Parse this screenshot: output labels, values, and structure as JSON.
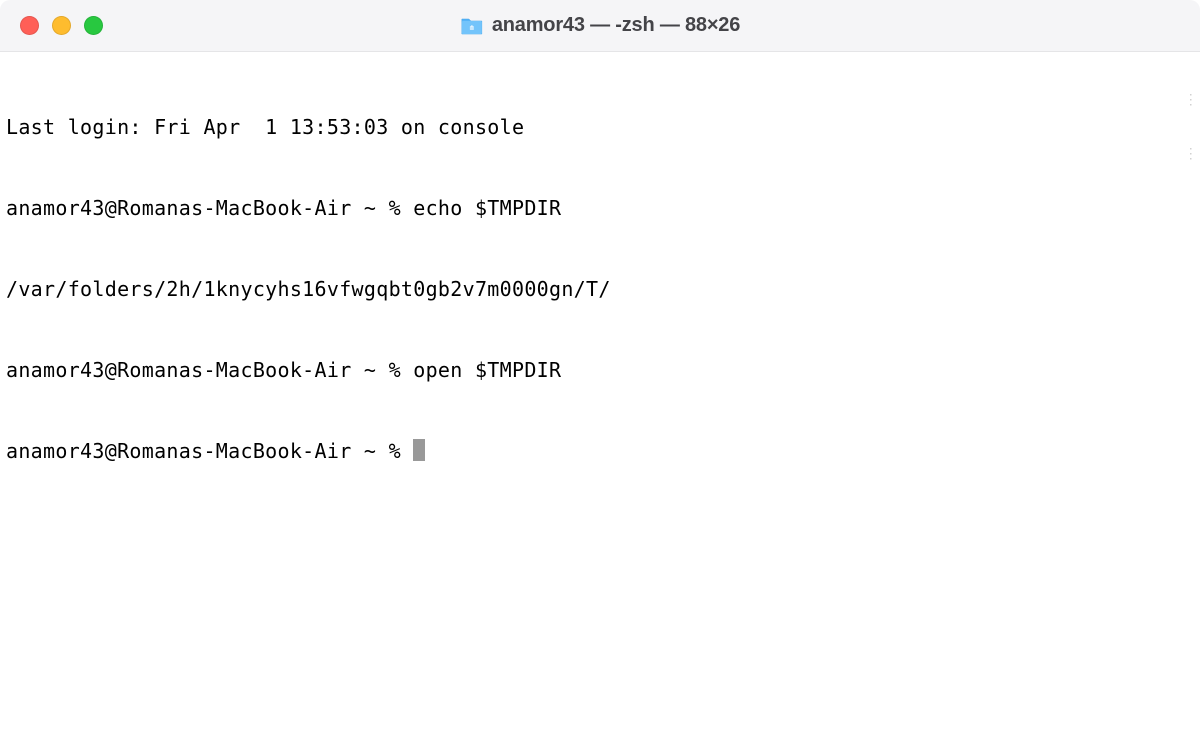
{
  "window": {
    "title": "anamor43 — -zsh — 88×26"
  },
  "terminal": {
    "lines": [
      "Last login: Fri Apr  1 13:53:03 on console",
      "anamor43@Romanas-MacBook-Air ~ % echo $TMPDIR",
      "/var/folders/2h/1knycyhs16vfwgqbt0gb2v7m0000gn/T/",
      "anamor43@Romanas-MacBook-Air ~ % open $TMPDIR",
      "anamor43@Romanas-MacBook-Air ~ % "
    ]
  }
}
